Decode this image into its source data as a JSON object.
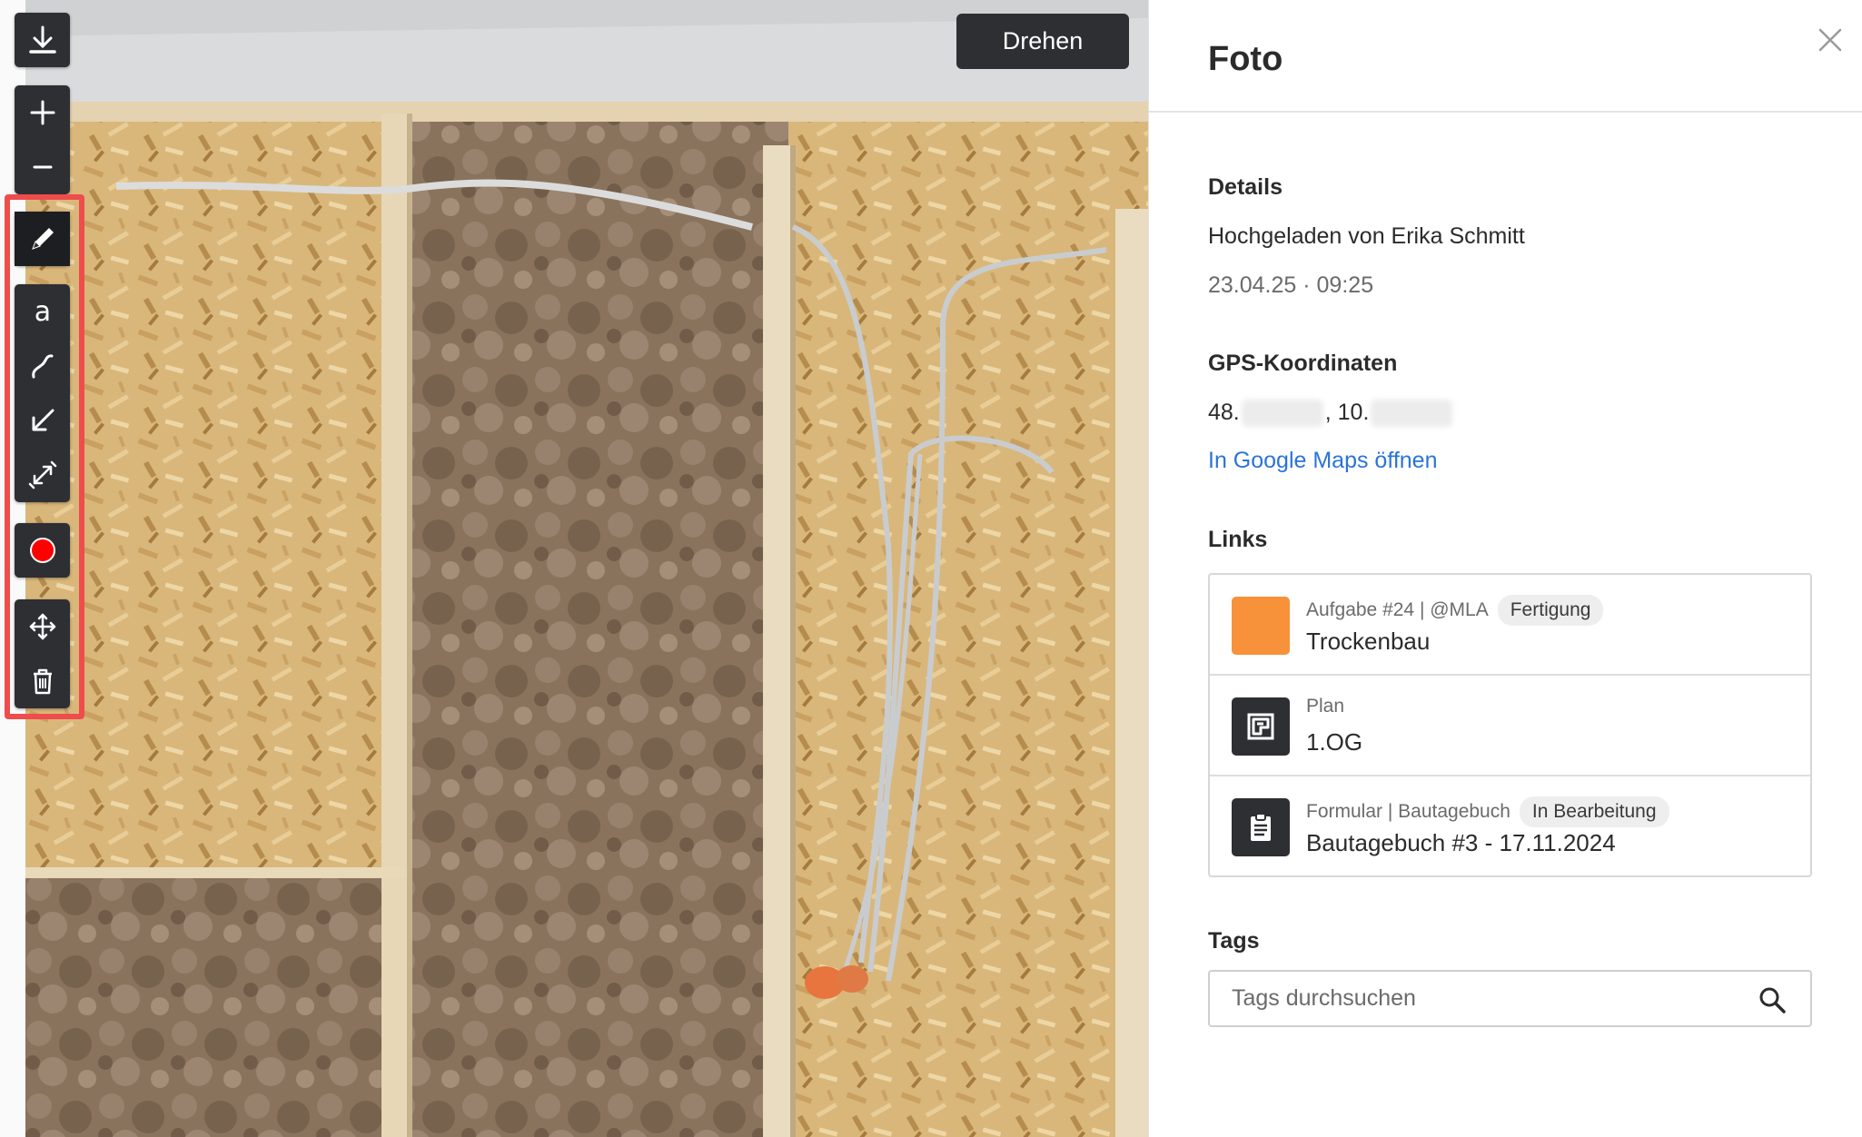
{
  "toolbar": {
    "groups": [
      [
        "download-icon"
      ],
      [
        "zoom-in-icon",
        "zoom-out-icon"
      ],
      [
        "pencil-icon"
      ],
      [
        "text-icon",
        "freehand-icon",
        "arrow-icon",
        "measure-icon"
      ],
      [
        "color-icon"
      ],
      [
        "move-icon",
        "trash-icon"
      ]
    ],
    "active_tool": "pencil-icon",
    "selected_color": "#ff0000"
  },
  "viewer": {
    "rotate_label": "Drehen"
  },
  "panel": {
    "title": "Foto",
    "details": {
      "heading": "Details",
      "uploaded_by": "Hochgeladen von Erika Schmitt",
      "datetime": "23.04.25 · 09:25"
    },
    "gps": {
      "heading": "GPS-Koordinaten",
      "lat_prefix": "48.",
      "lon_prefix": ", 10.",
      "maps_link": "In Google Maps öffnen"
    },
    "links": {
      "heading": "Links",
      "items": [
        {
          "meta": "Aufgabe #24 | @MLA",
          "chip": "Fertigung",
          "name": "Trockenbau",
          "icon": "task-color-swatch",
          "color": "#f7923a"
        },
        {
          "meta": "Plan",
          "chip": "",
          "name": "1.OG",
          "icon": "plan-icon",
          "color": "#2e2f33"
        },
        {
          "meta": "Formular | Bautagebuch",
          "chip": "In Bearbeitung",
          "name": "Bautagebuch #3 - 17.11.2024",
          "icon": "clipboard-icon",
          "color": "#2e2f33"
        }
      ]
    },
    "tags": {
      "heading": "Tags",
      "placeholder": "Tags durchsuchen"
    }
  }
}
